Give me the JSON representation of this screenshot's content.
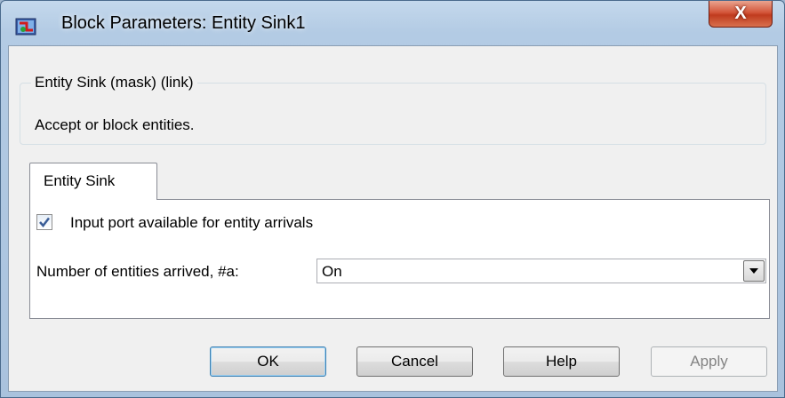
{
  "window": {
    "title": "Block Parameters: Entity Sink1",
    "close_glyph": "X",
    "app_icon": "simulink-block-icon"
  },
  "description": {
    "legend": "Entity Sink (mask) (link)",
    "text": "Accept or block entities."
  },
  "tabs": [
    {
      "label": "Entity Sink",
      "active": true
    }
  ],
  "parameters": {
    "input_port": {
      "label": "Input port available for entity arrivals",
      "checked": true
    },
    "entities_arrived": {
      "label": "Number of entities arrived, #a:",
      "value": "On"
    }
  },
  "buttons": {
    "ok": "OK",
    "cancel": "Cancel",
    "help": "Help",
    "apply": "Apply"
  },
  "colors": {
    "accent": "#3c7fb1",
    "close": "#c03b1e"
  }
}
